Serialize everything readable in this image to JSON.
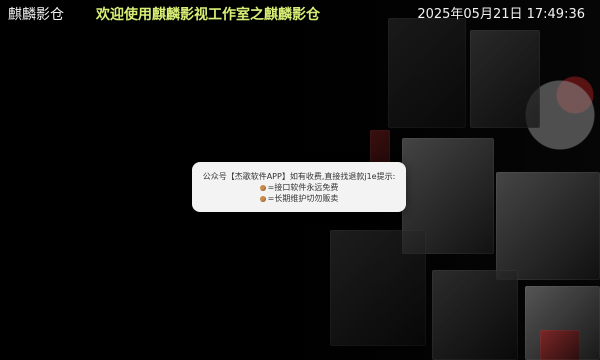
{
  "window": {
    "title": "麒麟影仓"
  },
  "header": {
    "app_title": "麒麟影仓",
    "welcome_text": "欢迎使用麒麟影视工作室之麒麟影仓",
    "datetime": "2025年05月21日 17:49:36"
  },
  "dialog": {
    "line1": "公众号【杰歌软件APP】如有收费,直接找退款j1e提示:",
    "line2": "=接口软件永远免费",
    "line3": "=长期维护切勿贩卖",
    "icon_name": "emoji-icon"
  },
  "colors": {
    "header_text": "#f2f2f2",
    "welcome_text": "#d8ef75",
    "dialog_bg": "#f3f3f3",
    "dialog_text": "#333333"
  }
}
